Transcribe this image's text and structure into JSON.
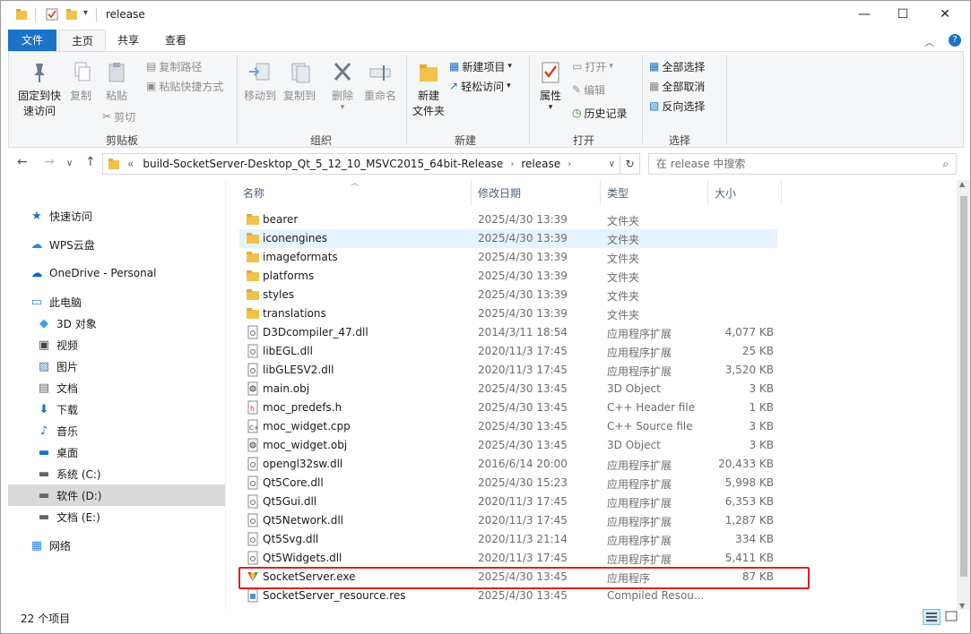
{
  "window": {
    "title": "release",
    "minimize": "—",
    "maximize": "☐",
    "close": "✕"
  },
  "ribbon_tabs": [
    "文件",
    "主页",
    "共享",
    "查看"
  ],
  "ribbon": {
    "clipboard": {
      "pin": "固定到快\n速访问",
      "copy": "复制",
      "paste": "粘贴",
      "copy_path": "复制路径",
      "paste_shortcut": "粘贴快捷方式",
      "cut": "剪切",
      "label": "剪贴板"
    },
    "organize": {
      "move_to": "移动到",
      "copy_to": "复制到",
      "delete": "删除",
      "rename": "重命名",
      "label": "组织"
    },
    "new": {
      "new_folder": "新建\n文件夹",
      "new_item": "新建项目",
      "easy_access": "轻松访问",
      "label": "新建"
    },
    "open": {
      "properties": "属性",
      "open": "打开",
      "edit": "编辑",
      "history": "历史记录",
      "label": "打开"
    },
    "select": {
      "select_all": "全部选择",
      "select_none": "全部取消",
      "invert": "反向选择",
      "label": "选择"
    }
  },
  "address": {
    "prefix": "«",
    "crumbs": [
      "build-SocketServer-Desktop_Qt_5_12_10_MSVC2015_64bit-Release",
      "release"
    ],
    "search_placeholder": "在 release 中搜索"
  },
  "nav_items": [
    {
      "label": "快速访问",
      "icon": "star-icon"
    },
    {
      "label": "WPS云盘",
      "icon": "cloud-icon"
    },
    {
      "label": "OneDrive - Personal",
      "icon": "onedrive-icon"
    },
    {
      "label": "此电脑",
      "icon": "computer-icon"
    },
    {
      "label": "3D 对象",
      "icon": "cube-icon"
    },
    {
      "label": "视频",
      "icon": "video-icon"
    },
    {
      "label": "图片",
      "icon": "picture-icon"
    },
    {
      "label": "文档",
      "icon": "document-icon"
    },
    {
      "label": "下载",
      "icon": "download-icon"
    },
    {
      "label": "音乐",
      "icon": "music-icon"
    },
    {
      "label": "桌面",
      "icon": "desktop-icon"
    },
    {
      "label": "系统 (C:)",
      "icon": "drive-icon"
    },
    {
      "label": "软件 (D:)",
      "icon": "drive-icon",
      "selected": true
    },
    {
      "label": "文档 (E:)",
      "icon": "drive-icon"
    },
    {
      "label": "网络",
      "icon": "network-icon"
    }
  ],
  "columns": {
    "name": "名称",
    "date": "修改日期",
    "type": "类型",
    "size": "大小"
  },
  "files": [
    {
      "name": "bearer",
      "date": "2025/4/30 13:39",
      "type": "文件夹",
      "size": "",
      "kind": "folder"
    },
    {
      "name": "iconengines",
      "date": "2025/4/30 13:39",
      "type": "文件夹",
      "size": "",
      "kind": "folder",
      "hover": true
    },
    {
      "name": "imageformats",
      "date": "2025/4/30 13:39",
      "type": "文件夹",
      "size": "",
      "kind": "folder"
    },
    {
      "name": "platforms",
      "date": "2025/4/30 13:39",
      "type": "文件夹",
      "size": "",
      "kind": "folder"
    },
    {
      "name": "styles",
      "date": "2025/4/30 13:39",
      "type": "文件夹",
      "size": "",
      "kind": "folder"
    },
    {
      "name": "translations",
      "date": "2025/4/30 13:39",
      "type": "文件夹",
      "size": "",
      "kind": "folder"
    },
    {
      "name": "D3Dcompiler_47.dll",
      "date": "2014/3/11 18:54",
      "type": "应用程序扩展",
      "size": "4,077 KB",
      "kind": "dll"
    },
    {
      "name": "libEGL.dll",
      "date": "2020/11/3 17:45",
      "type": "应用程序扩展",
      "size": "25 KB",
      "kind": "dll"
    },
    {
      "name": "libGLESV2.dll",
      "date": "2020/11/3 17:45",
      "type": "应用程序扩展",
      "size": "3,520 KB",
      "kind": "dll"
    },
    {
      "name": "main.obj",
      "date": "2025/4/30 13:45",
      "type": "3D Object",
      "size": "3 KB",
      "kind": "obj"
    },
    {
      "name": "moc_predefs.h",
      "date": "2025/4/30 13:45",
      "type": "C++ Header file",
      "size": "1 KB",
      "kind": "h"
    },
    {
      "name": "moc_widget.cpp",
      "date": "2025/4/30 13:45",
      "type": "C++ Source file",
      "size": "3 KB",
      "kind": "cpp"
    },
    {
      "name": "moc_widget.obj",
      "date": "2025/4/30 13:45",
      "type": "3D Object",
      "size": "3 KB",
      "kind": "obj"
    },
    {
      "name": "opengl32sw.dll",
      "date": "2016/6/14 20:00",
      "type": "应用程序扩展",
      "size": "20,433 KB",
      "kind": "dll"
    },
    {
      "name": "Qt5Core.dll",
      "date": "2025/4/30 15:23",
      "type": "应用程序扩展",
      "size": "5,998 KB",
      "kind": "dll"
    },
    {
      "name": "Qt5Gui.dll",
      "date": "2020/11/3 17:45",
      "type": "应用程序扩展",
      "size": "6,353 KB",
      "kind": "dll"
    },
    {
      "name": "Qt5Network.dll",
      "date": "2020/11/3 17:45",
      "type": "应用程序扩展",
      "size": "1,287 KB",
      "kind": "dll"
    },
    {
      "name": "Qt5Svg.dll",
      "date": "2020/11/3 21:14",
      "type": "应用程序扩展",
      "size": "334 KB",
      "kind": "dll"
    },
    {
      "name": "Qt5Widgets.dll",
      "date": "2020/11/3 17:45",
      "type": "应用程序扩展",
      "size": "5,411 KB",
      "kind": "dll"
    },
    {
      "name": "SocketServer.exe",
      "date": "2025/4/30 13:45",
      "type": "应用程序",
      "size": "87 KB",
      "kind": "exe",
      "highlighted": true
    },
    {
      "name": "SocketServer_resource.res",
      "date": "2025/4/30 13:45",
      "type": "Compiled Resou...",
      "size": "",
      "kind": "res"
    }
  ],
  "status": {
    "item_count": "22 个项目"
  },
  "colors": {
    "accent": "#1a73c7",
    "highlight_border": "#e02020",
    "folder": "#f0c24b"
  }
}
